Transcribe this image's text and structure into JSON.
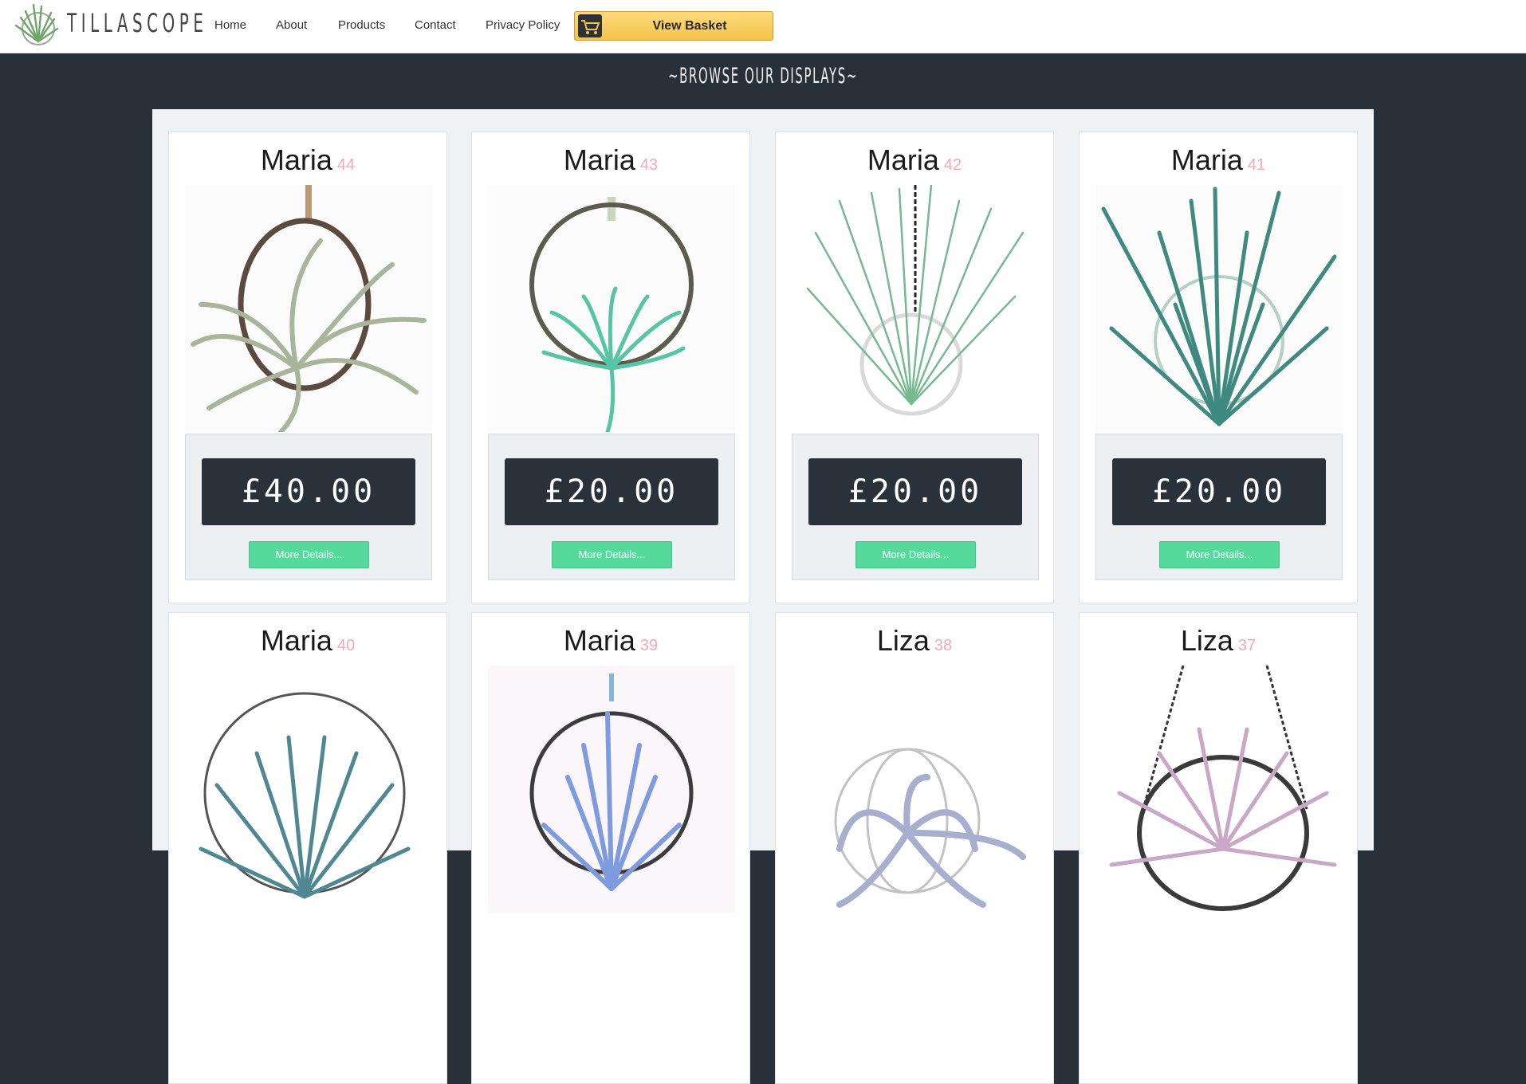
{
  "brand": {
    "name": "TILLASCOPE"
  },
  "nav": {
    "items": [
      "Home",
      "About",
      "Products",
      "Contact",
      "Privacy Policy"
    ]
  },
  "basket": {
    "label": "View Basket",
    "icon": "cart-icon"
  },
  "section": {
    "title": "~BROWSE OUR DISPLAYS~"
  },
  "colors": {
    "background": "#283039",
    "accent_button": "#55da9b",
    "price_bg": "#29313b",
    "basket_gold": "#f4c34b",
    "item_number": "#f3aab4"
  },
  "products": [
    {
      "name": "Maria",
      "number": "44",
      "price": "£40.00",
      "button": "More Details..."
    },
    {
      "name": "Maria",
      "number": "43",
      "price": "£20.00",
      "button": "More Details..."
    },
    {
      "name": "Maria",
      "number": "42",
      "price": "£20.00",
      "button": "More Details..."
    },
    {
      "name": "Maria",
      "number": "41",
      "price": "£20.00",
      "button": "More Details..."
    },
    {
      "name": "Maria",
      "number": "40"
    },
    {
      "name": "Maria",
      "number": "39"
    },
    {
      "name": "Liza",
      "number": "38"
    },
    {
      "name": "Liza",
      "number": "37"
    }
  ]
}
